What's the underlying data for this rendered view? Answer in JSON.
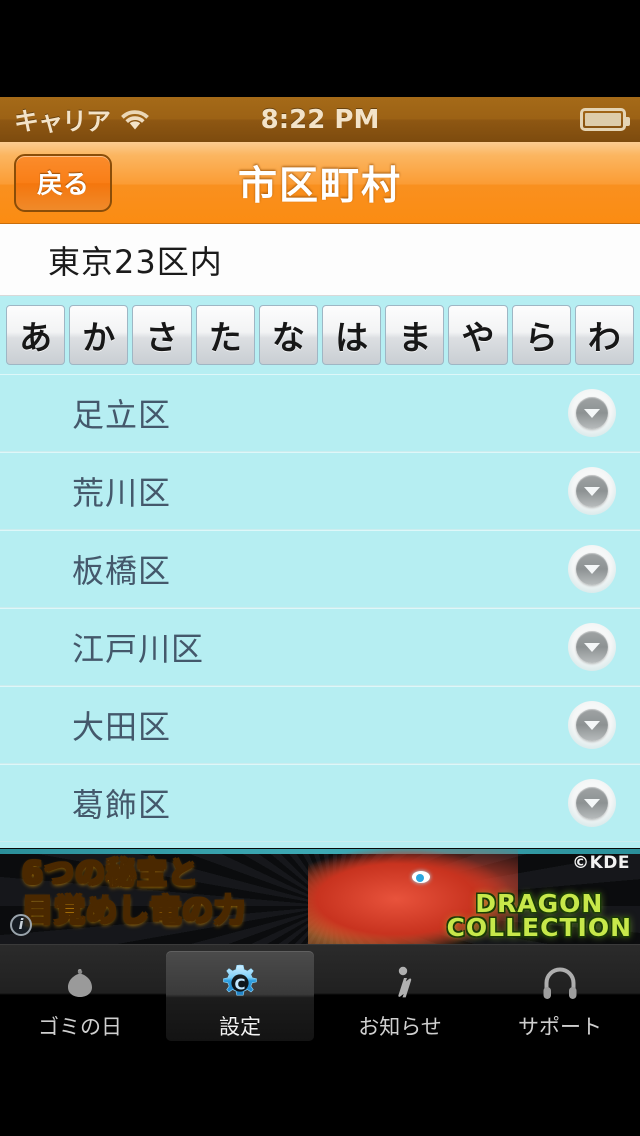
{
  "status_bar": {
    "carrier": "キャリア",
    "wifi_icon": "wifi-icon",
    "time": "8:22 PM",
    "battery_icon": "battery-icon"
  },
  "nav_bar": {
    "back_label": "戻る",
    "title": "市区町村"
  },
  "region_header": {
    "text": "東京23区内"
  },
  "kana_index": {
    "items": [
      {
        "label": "あ"
      },
      {
        "label": "か"
      },
      {
        "label": "さ"
      },
      {
        "label": "た"
      },
      {
        "label": "な"
      },
      {
        "label": "は"
      },
      {
        "label": "ま"
      },
      {
        "label": "や"
      },
      {
        "label": "ら"
      },
      {
        "label": "わ"
      }
    ]
  },
  "list": {
    "rows": [
      {
        "label": "足立区",
        "accessory": "chevron-down-circle-icon"
      },
      {
        "label": "荒川区",
        "accessory": "chevron-down-circle-icon"
      },
      {
        "label": "板橋区",
        "accessory": "chevron-down-circle-icon"
      },
      {
        "label": "江戸川区",
        "accessory": "chevron-down-circle-icon"
      },
      {
        "label": "大田区",
        "accessory": "chevron-down-circle-icon"
      },
      {
        "label": "葛飾区",
        "accessory": "chevron-down-circle-icon"
      }
    ]
  },
  "ad_banner": {
    "line1": "6つの秘宝と",
    "line2": "目覚めし竜の力",
    "brand_line1": "DRAGON",
    "brand_line2": "COLLECTION",
    "copyright": "©KDE",
    "info_badge": "i"
  },
  "tab_bar": {
    "tabs": [
      {
        "label": "ゴミの日",
        "icon": "trash-bag-icon",
        "active": false
      },
      {
        "label": "設定",
        "icon": "gear-icon",
        "active": true
      },
      {
        "label": "お知らせ",
        "icon": "info-icon",
        "active": false
      },
      {
        "label": "サポート",
        "icon": "headset-icon",
        "active": false
      }
    ]
  },
  "colors": {
    "nav_accent": "#fb9c34",
    "status_bar": "#9c6215",
    "list_background": "#b6eef2",
    "list_text": "#44586b",
    "kana_bar": "#b6eef2",
    "tab_bar": "#000000",
    "active_tab_icon": "#3fb6f0"
  }
}
